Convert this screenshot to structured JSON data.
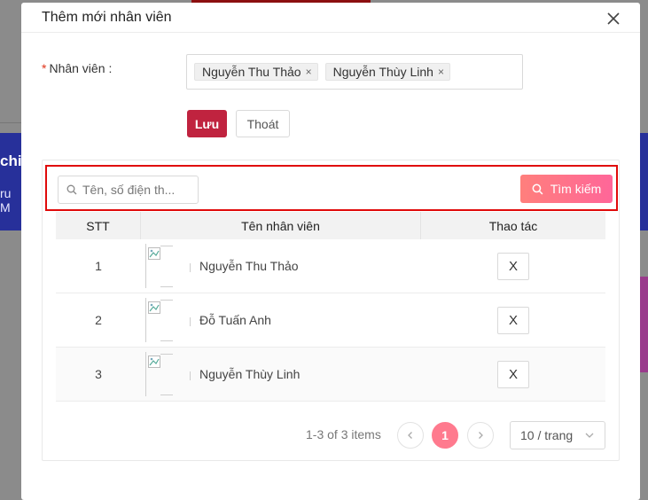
{
  "modal": {
    "title": "Thêm mới nhân viên"
  },
  "form": {
    "employee_label": "Nhân viên",
    "required_mark": "*",
    "colon": ":",
    "selected_tags": [
      "Nguyễn Thu Thảo",
      "Nguyễn Thùy Linh"
    ],
    "tag_remove": "×"
  },
  "actions": {
    "save_label": "Lưu",
    "exit_label": "Thoát"
  },
  "search": {
    "placeholder": "Tên, số điện th...",
    "button_label": "Tìm kiếm"
  },
  "table": {
    "headers": [
      "STT",
      "Tên nhân viên",
      "Thao tác"
    ],
    "rows": [
      {
        "stt": "1",
        "name": "Nguyễn Thu Thảo",
        "action": "X"
      },
      {
        "stt": "2",
        "name": "Đỗ Tuấn Anh",
        "action": "X"
      },
      {
        "stt": "3",
        "name": "Nguyễn Thùy Linh",
        "action": "X"
      }
    ]
  },
  "pagination": {
    "info": "1-3 of 3 items",
    "current_page": "1",
    "page_size": "10 / trang"
  },
  "background": {
    "left_card_text1": "chi",
    "left_card_text2": "ru M"
  },
  "colors": {
    "save_button": "#c0233f",
    "search_gradient_start": "#ff7f7c",
    "search_gradient_end": "#ff6699",
    "highlight_border": "#e00a0a",
    "current_page": "#ff7a8e"
  },
  "icons": [
    "close-icon",
    "search-icon",
    "chevron-left-icon",
    "chevron-right-icon",
    "chevron-down-icon",
    "broken-image-icon"
  ]
}
